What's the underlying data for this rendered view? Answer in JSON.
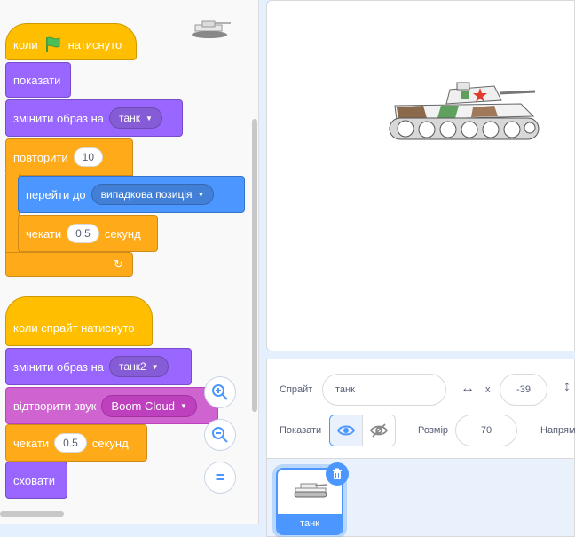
{
  "script1": {
    "hat_when": "коли",
    "hat_clicked": "натиснуто",
    "show": "показати",
    "switch_costume": "змінити образ на",
    "costume1": "танк",
    "repeat": "повторити",
    "repeat_count": "10",
    "go_to": "перейти до",
    "go_target": "випадкова позиція",
    "wait": "чекати",
    "wait_value": "0.5",
    "seconds": "секунд"
  },
  "script2": {
    "hat": "коли спрайт натиснуто",
    "switch_costume": "змінити образ на",
    "costume2": "танк2",
    "play_sound": "відтворити звук",
    "sound_name": "Boom Cloud",
    "wait": "чекати",
    "wait_value": "0.5",
    "seconds": "секунд",
    "hide": "сховати"
  },
  "zoom": {
    "in": "+",
    "out": "−",
    "reset": "="
  },
  "sprite_info": {
    "sprite_label": "Спрайт",
    "sprite_name": "танк",
    "x_label": "x",
    "x_value": "-39",
    "show_label": "Показати",
    "size_label": "Розмір",
    "size_value": "70",
    "direction_label": "Напрям"
  },
  "sprite_list": {
    "items": [
      {
        "name": "танк"
      }
    ]
  },
  "colors": {
    "events": "#ffbf00",
    "looks": "#9966ff",
    "control": "#ffab19",
    "motion": "#4c97ff",
    "sound": "#cf63cf"
  }
}
